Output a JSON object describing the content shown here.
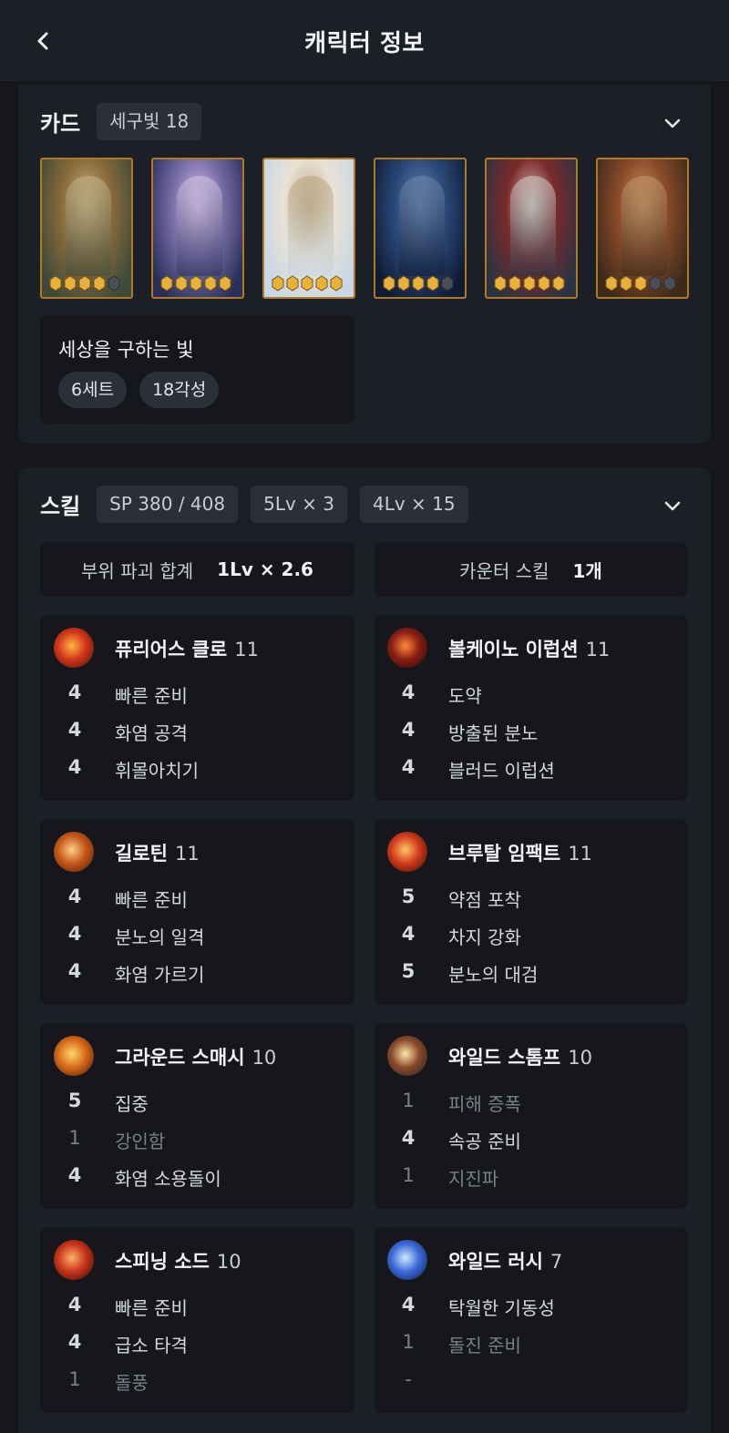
{
  "header": {
    "title": "캐릭터 정보"
  },
  "cards": {
    "title": "카드",
    "badge": "세구빛 18",
    "items": [
      {
        "name": "card-1",
        "awake": 4,
        "palette": [
          "#3d4a3a",
          "#8a6a3a",
          "#c9b78a"
        ]
      },
      {
        "name": "card-2",
        "awake": 5,
        "palette": [
          "#2a2f5a",
          "#7a6fa8",
          "#d8c6e8"
        ]
      },
      {
        "name": "card-3",
        "awake": 5,
        "palette": [
          "#c8d6e6",
          "#e8e2d6",
          "#b9a27a"
        ]
      },
      {
        "name": "card-4",
        "awake": 4,
        "palette": [
          "#0f1a33",
          "#2a4a7a",
          "#6f88b0"
        ]
      },
      {
        "name": "card-5",
        "awake": 5,
        "palette": [
          "#2a3344",
          "#7a2a2a",
          "#d8d0c8"
        ]
      },
      {
        "name": "card-6",
        "awake": 3,
        "palette": [
          "#3a2a1a",
          "#8a4a2a",
          "#c89a6a"
        ]
      }
    ],
    "set": {
      "name": "세상을 구하는 빛",
      "tags": [
        "6세트",
        "18각성"
      ]
    }
  },
  "skills": {
    "title": "스킬",
    "badges": [
      "SP 380 / 408",
      "5Lv × 3",
      "4Lv × 15"
    ],
    "summary": [
      {
        "label": "부위 파괴 합계",
        "value": "1Lv × 2.6"
      },
      {
        "label": "카운터 스킬",
        "value": "1개"
      }
    ],
    "list": [
      {
        "name": "퓨리어스 클로",
        "level": "11",
        "icon": "fire-claw-icon",
        "tripods": [
          {
            "lv": "4",
            "name": "빠른 준비"
          },
          {
            "lv": "4",
            "name": "화염 공격"
          },
          {
            "lv": "4",
            "name": "휘몰아치기"
          }
        ]
      },
      {
        "name": "볼케이노 이럽션",
        "level": "11",
        "icon": "volcano-icon",
        "tripods": [
          {
            "lv": "4",
            "name": "도약"
          },
          {
            "lv": "4",
            "name": "방출된 분노"
          },
          {
            "lv": "4",
            "name": "블러드 이럽션"
          }
        ]
      },
      {
        "name": "길로틴",
        "level": "11",
        "icon": "guillotine-icon",
        "tripods": [
          {
            "lv": "4",
            "name": "빠른 준비"
          },
          {
            "lv": "4",
            "name": "분노의 일격"
          },
          {
            "lv": "4",
            "name": "화염 가르기"
          }
        ]
      },
      {
        "name": "브루탈 임팩트",
        "level": "11",
        "icon": "brutal-impact-icon",
        "tripods": [
          {
            "lv": "5",
            "name": "약점 포착"
          },
          {
            "lv": "4",
            "name": "차지 강화"
          },
          {
            "lv": "5",
            "name": "분노의 대검"
          }
        ]
      },
      {
        "name": "그라운드 스매시",
        "level": "10",
        "icon": "ground-smash-icon",
        "tripods": [
          {
            "lv": "5",
            "name": "집중"
          },
          {
            "lv": "1",
            "name": "강인함",
            "dim": true
          },
          {
            "lv": "4",
            "name": "화염 소용돌이"
          }
        ]
      },
      {
        "name": "와일드 스톰프",
        "level": "10",
        "icon": "wild-stomp-icon",
        "tripods": [
          {
            "lv": "1",
            "name": "피해 증폭",
            "dim": true
          },
          {
            "lv": "4",
            "name": "속공 준비"
          },
          {
            "lv": "1",
            "name": "지진파",
            "dim": true
          }
        ]
      },
      {
        "name": "스피닝 소드",
        "level": "10",
        "icon": "spinning-sword-icon",
        "tripods": [
          {
            "lv": "4",
            "name": "빠른 준비"
          },
          {
            "lv": "4",
            "name": "급소 타격"
          },
          {
            "lv": "1",
            "name": "돌풍",
            "dim": true
          }
        ]
      },
      {
        "name": "와일드 러시",
        "level": "7",
        "icon": "wild-rush-icon",
        "tripods": [
          {
            "lv": "4",
            "name": "탁월한 기동성"
          },
          {
            "lv": "1",
            "name": "돌진 준비",
            "dim": true
          },
          {
            "lv": "-",
            "name": "",
            "dim": true
          }
        ]
      }
    ]
  }
}
